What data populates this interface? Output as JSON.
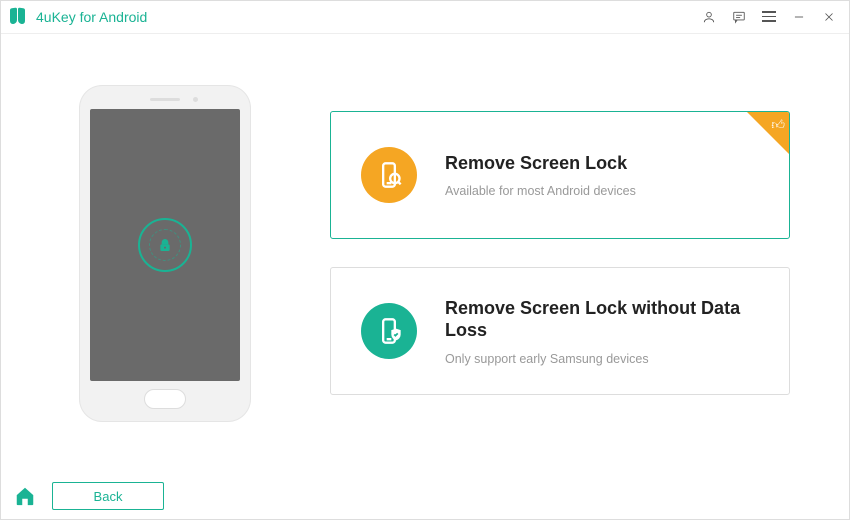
{
  "app": {
    "title": "4uKey for Android"
  },
  "options": [
    {
      "title": "Remove Screen Lock",
      "subtitle": "Available for most Android devices",
      "selected": true,
      "recommended": true,
      "color": "orange"
    },
    {
      "title": "Remove Screen Lock without Data Loss",
      "subtitle": "Only support early Samsung devices",
      "selected": false,
      "recommended": false,
      "color": "green"
    }
  ],
  "footer": {
    "back_label": "Back"
  },
  "colors": {
    "accent": "#1ab394",
    "warn": "#f5a623"
  }
}
